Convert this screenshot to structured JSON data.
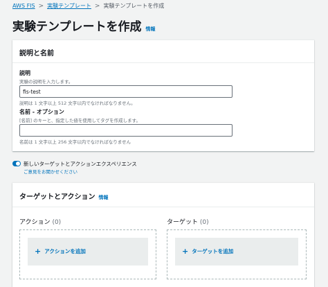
{
  "breadcrumb": {
    "items": [
      "AWS FIS",
      "実験テンプレート",
      "実験テンプレートを作成"
    ],
    "separator": ">"
  },
  "page": {
    "title": "実験テンプレートを作成",
    "info_link": "情報"
  },
  "description_panel": {
    "title": "説明と名前",
    "description_field": {
      "label": "説明",
      "hint": "実験の説明を入力します。",
      "value": "fis-test",
      "constraint": "説明は 1 文字以上 512 文字以内でなければなりません。"
    },
    "name_field": {
      "label": "名前 - オプション",
      "hint": "[名前] のキーと、指定した値を使用してタグを作成します。",
      "value": "",
      "constraint": "名前は 1 文字以上 256 文字以内でなければなりません"
    }
  },
  "experience_toggle": {
    "label": "新しいターゲットとアクションエクスペリエンス",
    "feedback_link": "ご意見をお聞かせください",
    "enabled": true
  },
  "targets_actions_panel": {
    "title": "ターゲットとアクション",
    "info_link": "情報",
    "actions": {
      "title": "アクション",
      "count": "(0)",
      "add_button": "アクションを追加"
    },
    "targets": {
      "title": "ターゲット",
      "count": "(0)",
      "add_button": "ターゲットを追加"
    }
  },
  "colors": {
    "link": "#0073bb",
    "background": "#f2f3f3",
    "panel": "#ffffff",
    "text": "#16191f"
  }
}
